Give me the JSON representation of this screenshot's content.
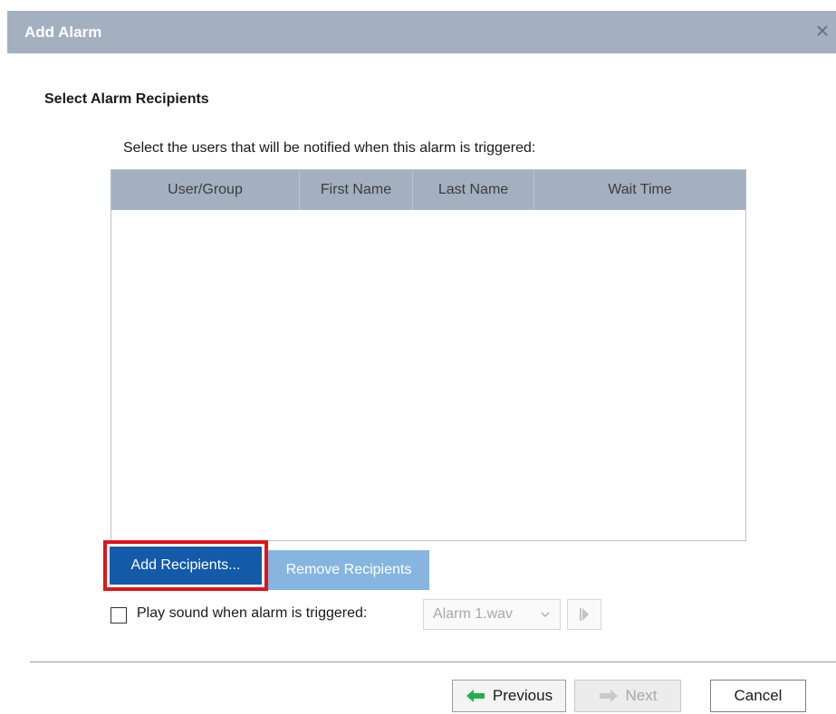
{
  "window": {
    "title": "Add Alarm",
    "close_symbol": "×"
  },
  "step": {
    "title": "Select Alarm Recipients",
    "instruction": "Select the users that will be notified when this alarm is triggered:"
  },
  "table": {
    "columns": [
      "User/Group",
      "First Name",
      "Last Name",
      "Wait Time"
    ],
    "rows": []
  },
  "buttons": {
    "add_recipients": "Add Recipients...",
    "remove_recipients": "Remove Recipients"
  },
  "sound": {
    "label": "Play sound when alarm is triggered:",
    "checked": false,
    "selected_file": "Alarm 1.wav"
  },
  "footer": {
    "previous": "Previous",
    "next": "Next",
    "cancel": "Cancel"
  },
  "colors": {
    "title_bar": "#a4b0c0",
    "primary_button": "#135aa8",
    "disabled_button": "#86b6e0",
    "highlight_box": "#e0141b",
    "previous_arrow": "#1eb24b"
  },
  "icons": [
    "close-icon",
    "chevron-down-icon",
    "play-icon",
    "arrow-left-icon",
    "arrow-right-icon"
  ]
}
